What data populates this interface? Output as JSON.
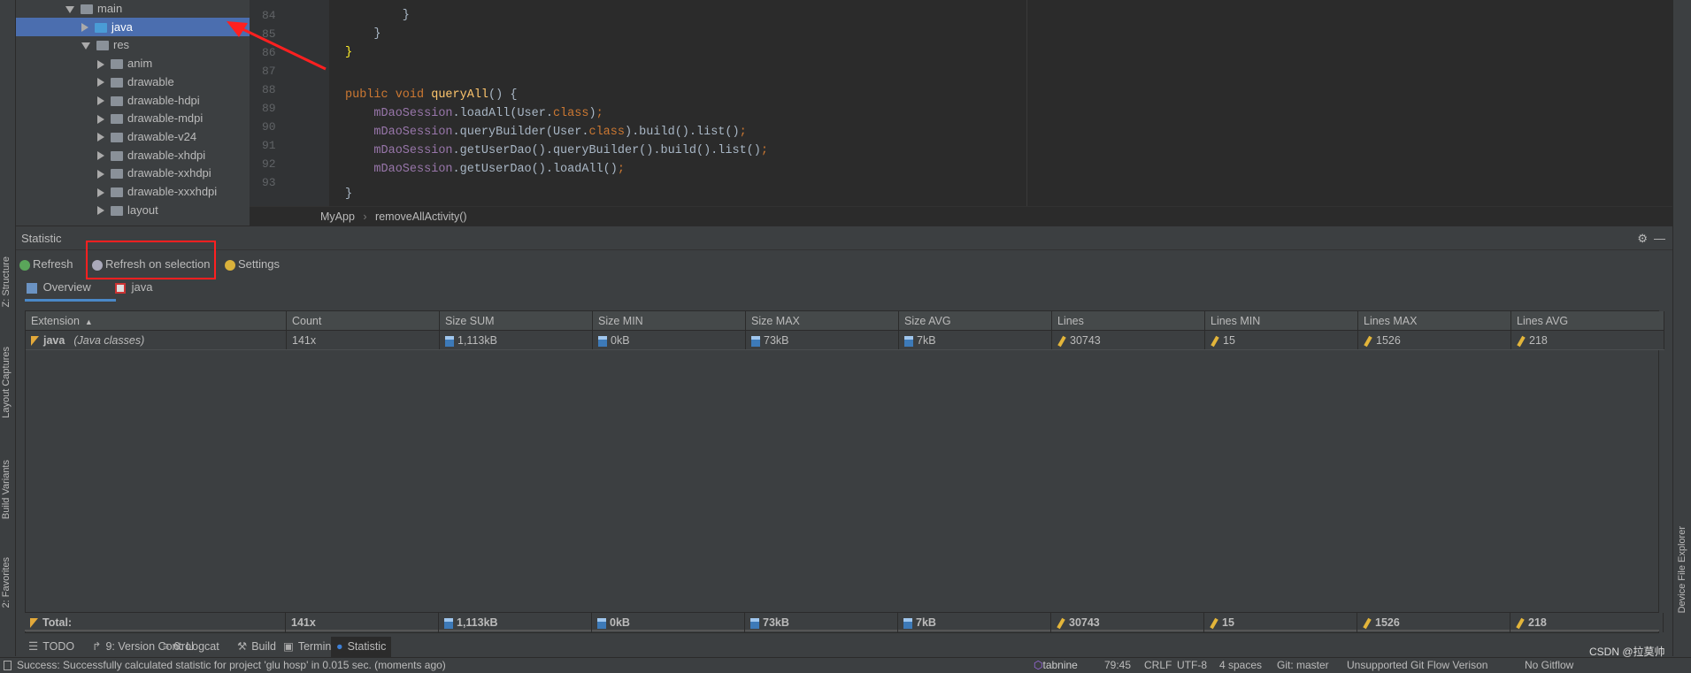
{
  "tree": [
    {
      "label": "main",
      "expanded": true,
      "indent": 1
    },
    {
      "label": "java",
      "expanded": false,
      "indent": 2,
      "selected": true
    },
    {
      "label": "res",
      "expanded": true,
      "indent": 2
    },
    {
      "label": "anim",
      "indent": 3
    },
    {
      "label": "drawable",
      "indent": 3
    },
    {
      "label": "drawable-hdpi",
      "indent": 3
    },
    {
      "label": "drawable-mdpi",
      "indent": 3
    },
    {
      "label": "drawable-v24",
      "indent": 3
    },
    {
      "label": "drawable-xhdpi",
      "indent": 3
    },
    {
      "label": "drawable-xxhdpi",
      "indent": 3
    },
    {
      "label": "drawable-xxxhdpi",
      "indent": 3
    },
    {
      "label": "layout",
      "indent": 3
    }
  ],
  "editor": {
    "line_numbers": [
      "84",
      "85",
      "86",
      "87",
      "88",
      "89",
      "90",
      "91",
      "92",
      "93"
    ],
    "breadcrumb": [
      "MyApp",
      "removeAllActivity()"
    ]
  },
  "panel": {
    "title": "Statistic",
    "toolbar": {
      "refresh": "Refresh",
      "refresh_on_selection": "Refresh on selection",
      "settings": "Settings"
    },
    "tabs": [
      "Overview",
      "java"
    ],
    "columns": [
      "Extension",
      "Count",
      "Size SUM",
      "Size MIN",
      "Size MAX",
      "Size AVG",
      "Lines",
      "Lines MIN",
      "Lines MAX",
      "Lines AVG"
    ],
    "row": {
      "ext": "java",
      "desc": "(Java classes)",
      "values": [
        "141x",
        "1,113kB",
        "0kB",
        "73kB",
        "7kB",
        "30743",
        "15",
        "1526",
        "218"
      ]
    },
    "total": {
      "label": "Total:",
      "values": [
        "141x",
        "1,113kB",
        "0kB",
        "73kB",
        "7kB",
        "30743",
        "15",
        "1526",
        "218"
      ]
    }
  },
  "side_tools": {
    "left": [
      "Z: Structure",
      "Layout Captures",
      "Build Variants",
      "2: Favorites"
    ],
    "right": [
      "Device File Explorer"
    ]
  },
  "bottom_tabs": [
    "TODO",
    "9: Version Control",
    "6: Logcat",
    "Build",
    "Terminal",
    "Statistic"
  ],
  "status": {
    "message": "Success: Successfully calculated statistic for project 'glu hosp' in 0.015 sec. (moments ago)",
    "tabnine": "tabnine",
    "position": "79:45",
    "line_sep": "CRLF",
    "encoding": "UTF-8",
    "indent": "4 spaces",
    "git": "Git: master",
    "gitflow": "Unsupported Git Flow Verison",
    "no_gitflow": "No Gitflow"
  },
  "watermark": "CSDN @拉莫帅",
  "colors": {
    "selection": "#4b6eaf",
    "accent_tab": "#4a88c7",
    "annotation": "#ff2020"
  }
}
